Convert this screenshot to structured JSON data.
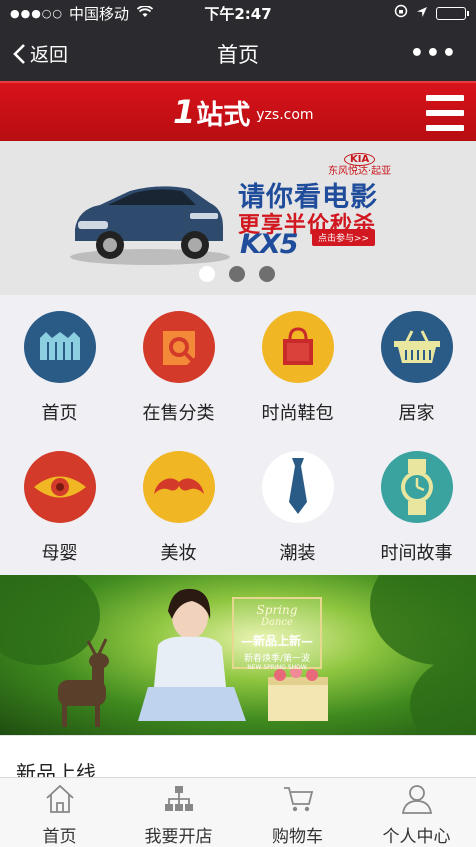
{
  "status_bar": {
    "signal": "●●●○○",
    "carrier": "中国移动",
    "time": "下午2:47",
    "battery_level": 0.9
  },
  "nav": {
    "back_label": "返回",
    "title": "首页",
    "more": "•••"
  },
  "brand": {
    "logo_one": "1",
    "logo_cn": "站式",
    "logo_domain": "yzs.com"
  },
  "banner": {
    "brand_mark": "KIA",
    "brand_sub": "东风悦达·起亚",
    "headline": "请你看电影",
    "subline": "更享半价秒杀",
    "model": "KX5",
    "cta": "点击参与>>",
    "slide_count": 3,
    "active_slide": 0
  },
  "categories": [
    {
      "label": "首页",
      "icon": "crown-icon",
      "color": "#2a5a86"
    },
    {
      "label": "在售分类",
      "icon": "search-bubble-icon",
      "color": "#d33a2a"
    },
    {
      "label": "时尚鞋包",
      "icon": "handbag-icon",
      "color": "#f0b623"
    },
    {
      "label": "居家",
      "icon": "basket-icon",
      "color": "#2a5a86"
    },
    {
      "label": "母婴",
      "icon": "eye-icon",
      "color": "#d33a2a"
    },
    {
      "label": "美妆",
      "icon": "mustache-icon",
      "color": "#f0b623"
    },
    {
      "label": "潮装",
      "icon": "necktie-icon",
      "color": "#ffffff"
    },
    {
      "label": "时间故事",
      "icon": "watch-icon",
      "color": "#3aa3a0"
    }
  ],
  "banner2": {
    "line1": "Spring",
    "line2": "Dance",
    "line3": "—新品上新—",
    "line4": "新春焕季/第一波",
    "line5": "NEW SPRING SHOW"
  },
  "section": {
    "title": "新品上线"
  },
  "tabs": [
    {
      "label": "首页",
      "icon": "home-icon"
    },
    {
      "label": "我要开店",
      "icon": "sitemap-icon"
    },
    {
      "label": "购物车",
      "icon": "cart-icon"
    },
    {
      "label": "个人中心",
      "icon": "user-icon"
    }
  ]
}
